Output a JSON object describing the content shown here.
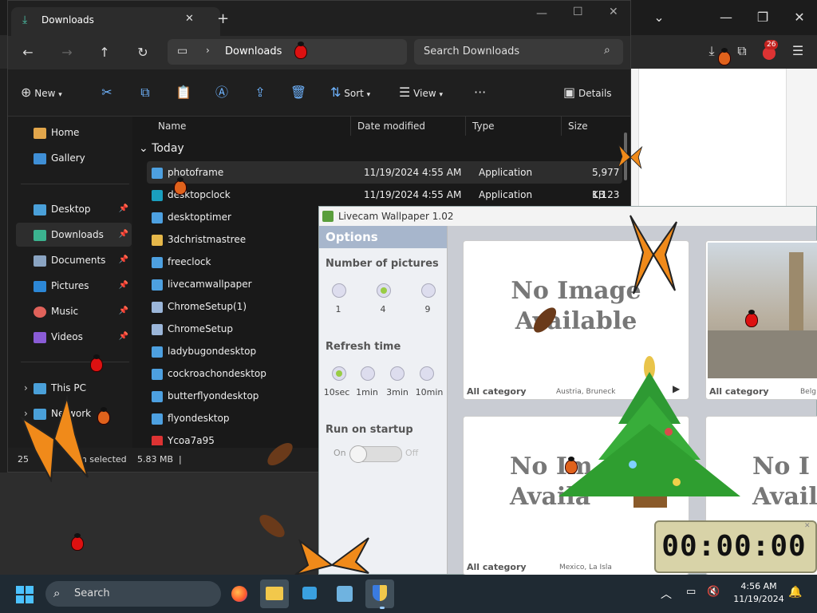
{
  "explorer": {
    "tab_title": "Downloads",
    "address": "Downloads",
    "search_placeholder": "Search Downloads",
    "commands": {
      "new": "New",
      "sort": "Sort",
      "view": "View",
      "details": "Details",
      "more": "···"
    },
    "sidebar": {
      "items": [
        {
          "label": "Home",
          "icon": "home-icon"
        },
        {
          "label": "Gallery",
          "icon": "gallery-icon"
        },
        {
          "label": "Desktop",
          "icon": "desktop-icon",
          "pinned": true
        },
        {
          "label": "Downloads",
          "icon": "downloads-icon",
          "pinned": true,
          "active": true
        },
        {
          "label": "Documents",
          "icon": "documents-icon",
          "pinned": true
        },
        {
          "label": "Pictures",
          "icon": "pictures-icon",
          "pinned": true
        },
        {
          "label": "Music",
          "icon": "music-icon",
          "pinned": true
        },
        {
          "label": "Videos",
          "icon": "videos-icon",
          "pinned": true
        },
        {
          "label": "This PC",
          "icon": "pc-icon"
        },
        {
          "label": "Network",
          "icon": "network-icon"
        }
      ]
    },
    "columns": {
      "name": "Name",
      "date": "Date modified",
      "type": "Type",
      "size": "Size"
    },
    "group": "Today",
    "files": [
      {
        "name": "photoframe",
        "date": "11/19/2024 4:55 AM",
        "type": "Application",
        "size": "5,977 KB",
        "selected": true
      },
      {
        "name": "desktopclock",
        "date": "11/19/2024 4:55 AM",
        "type": "Application",
        "size": "1,123 KB"
      },
      {
        "name": "desktoptimer"
      },
      {
        "name": "3dchristmastree"
      },
      {
        "name": "freeclock"
      },
      {
        "name": "livecamwallpaper"
      },
      {
        "name": "ChromeSetup(1)"
      },
      {
        "name": "ChromeSetup"
      },
      {
        "name": "ladybugondesktop"
      },
      {
        "name": "cockroachondesktop"
      },
      {
        "name": "butterflyondesktop"
      },
      {
        "name": "flyondesktop"
      },
      {
        "name": "Ycoa7a95"
      }
    ],
    "status": {
      "count": "25",
      "selected": "m selected",
      "size": "5.83 MB"
    }
  },
  "livecam": {
    "title": "Livecam Wallpaper 1.02",
    "options_title": "Options",
    "number_heading": "Number of pictures",
    "number_options": [
      "1",
      "4",
      "9"
    ],
    "number_selected": "4",
    "refresh_heading": "Refresh time",
    "refresh_options": [
      "10sec",
      "1min",
      "3min",
      "10min"
    ],
    "refresh_selected": "10sec",
    "startup_heading": "Run on startup",
    "toggle_on": "On",
    "toggle_off": "Off",
    "cards": [
      {
        "no_image_1": "No Image",
        "no_image_2": "Available",
        "category": "All category",
        "location": "Austria, Bruneck"
      },
      {
        "category": "All category",
        "location": "Belg"
      },
      {
        "no_image_1": "No Im",
        "no_image_2": "Availa",
        "category": "All category",
        "location": "Mexico, La Isla"
      },
      {
        "no_image_1": "No I",
        "no_image_2": "Avail"
      }
    ]
  },
  "clock": {
    "digits": "00:00:00"
  },
  "browser": {
    "badge": "26"
  },
  "taskbar": {
    "search": "Search",
    "time": "4:56 AM",
    "date": "11/19/2024"
  },
  "colors": {
    "accent": "#4da0e0",
    "taskbar": "#1f2a33",
    "livecam_header": "#a7b6cc"
  }
}
